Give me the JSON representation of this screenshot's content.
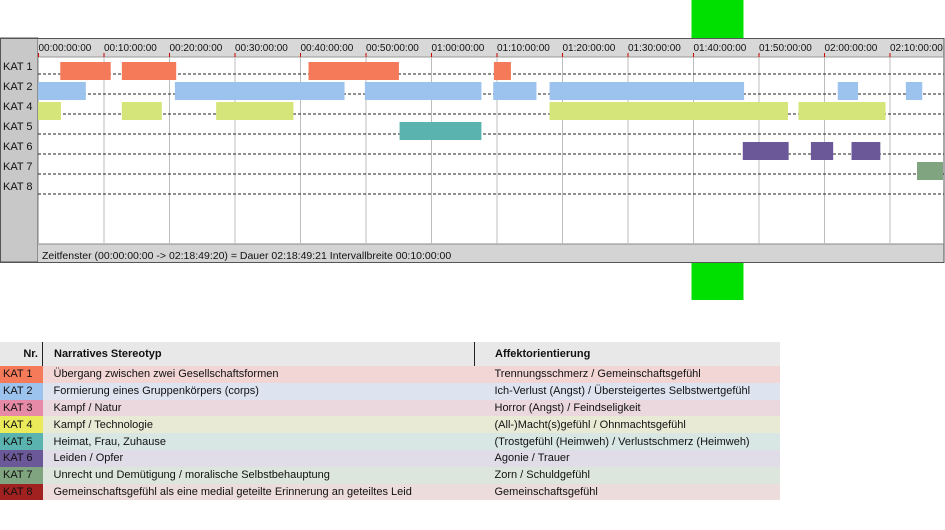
{
  "chart_data": {
    "type": "gantt",
    "time_ticks": [
      "00:00:00:00",
      "00:10:00:00",
      "00:20:00:00",
      "00:30:00:00",
      "00:40:00:00",
      "00:50:00:00",
      "01:00:00:00",
      "01:10:00:00",
      "01:20:00:00",
      "01:30:00:00",
      "01:40:00:00",
      "01:50:00:00",
      "02:00:00:00",
      "02:10:00:00"
    ],
    "tick_minutes": [
      0,
      10,
      20,
      30,
      40,
      50,
      60,
      70,
      80,
      90,
      100,
      110,
      120,
      130
    ],
    "x_range_minutes": [
      0,
      138.82
    ],
    "rows": [
      "KAT 1",
      "KAT 2",
      "KAT 4",
      "KAT 5",
      "KAT 6",
      "KAT 7",
      "KAT 8"
    ],
    "intervals": [
      {
        "row": "KAT 1",
        "color": "#f47a5a",
        "segments": [
          [
            3.4,
            11.1
          ],
          [
            12.8,
            21.1
          ],
          [
            41.3,
            55.1
          ],
          [
            69.6,
            72.2
          ]
        ]
      },
      {
        "row": "KAT 2",
        "color": "#9cc2ee",
        "segments": [
          [
            0,
            7.3
          ],
          [
            20.9,
            46.8
          ],
          [
            49.9,
            67.7
          ],
          [
            69.5,
            76.1
          ],
          [
            78.1,
            107.8
          ],
          [
            122.1,
            125.2
          ],
          [
            132.5,
            135.0
          ]
        ]
      },
      {
        "row": "KAT 4",
        "color": "#d6e57a",
        "segments": [
          [
            0,
            3.5
          ],
          [
            12.8,
            18.9
          ],
          [
            27.2,
            39.0
          ],
          [
            78.1,
            114.5
          ],
          [
            116.1,
            129.4
          ]
        ]
      },
      {
        "row": "KAT 5",
        "color": "#5ab3ae",
        "segments": [
          [
            55.2,
            67.7
          ]
        ]
      },
      {
        "row": "KAT 6",
        "color": "#6b5898",
        "segments": [
          [
            107.6,
            114.6
          ],
          [
            118.0,
            121.4
          ],
          [
            124.2,
            128.6
          ]
        ]
      },
      {
        "row": "KAT 7",
        "color": "#7fa47f",
        "segments": [
          [
            134.2,
            138.82
          ]
        ]
      },
      {
        "row": "KAT 8",
        "color": "#8b1a1a",
        "segments": []
      }
    ],
    "footer": "Zeitfenster (00:00:00:00 -> 02:18:49:20) = Dauer 02:18:49:21     Intervallbreite 00:10:00:00",
    "marker_color": "#00e000",
    "marker_minute": 100
  },
  "legend": {
    "header": {
      "nr": "Nr.",
      "stereotyp": "Narratives Stereotyp",
      "affekt": "Affektorientierung"
    },
    "rows": [
      {
        "code": "KAT 1",
        "stereotyp": "Übergang zwischen zwei Gesellschaftsformen",
        "affekt": "Trennungsschmerz / Gemeinschaftsgefühl",
        "color": "#f47a5a",
        "bg": "#f2d6d6"
      },
      {
        "code": "KAT 2",
        "stereotyp": "Formierung eines Gruppenkörpers (corps)",
        "affekt": "Ich-Verlust (Angst) / Übersteigertes Selbstwertgefühl",
        "color": "#9cc2ee",
        "bg": "#dde4f0"
      },
      {
        "code": "KAT 3",
        "stereotyp": "Kampf / Natur",
        "affekt": "Horror (Angst) / Feindseligkeit",
        "color": "#e68aa8",
        "bg": "#ead8de"
      },
      {
        "code": "KAT 4",
        "stereotyp": "Kampf / Technologie",
        "affekt": "(All-)Macht(s)gefühl / Ohnmachtsgefühl",
        "color": "#eaea5a",
        "bg": "#e8ead6"
      },
      {
        "code": "KAT 5",
        "stereotyp": "Heimat, Frau, Zuhause",
        "affekt": "(Trostgefühl (Heimweh) / Verlustschmerz (Heimweh)",
        "color": "#5ab3ae",
        "bg": "#d8e6e4"
      },
      {
        "code": "KAT 6",
        "stereotyp": "Leiden / Opfer",
        "affekt": "Agonie / Trauer",
        "color": "#6b5898",
        "bg": "#e0dce8"
      },
      {
        "code": "KAT 7",
        "stereotyp": "Unrecht und Demütigung / moralische Selbstbehauptung",
        "affekt": "Zorn / Schuldgefühl",
        "color": "#7fa47f",
        "bg": "#dce6dc"
      },
      {
        "code": "KAT 8",
        "stereotyp": "Gemeinschaftsgefühl als eine medial geteilte Erinnerung an geteiltes Leid",
        "affekt": "Gemeinschaftsgefühl",
        "color": "#a12020",
        "bg": "#ecdcdc"
      }
    ]
  }
}
